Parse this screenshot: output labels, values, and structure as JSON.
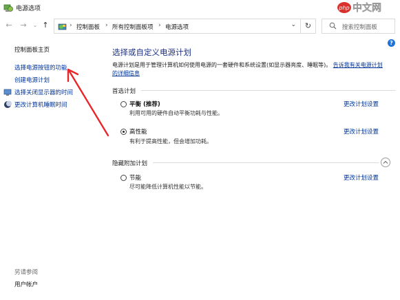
{
  "window": {
    "title": "电源选项",
    "watermark": "php中文网"
  },
  "address": {
    "crumbs": [
      "控制面板",
      "所有控制面板项",
      "电源选项"
    ]
  },
  "search": {
    "placeholder": "搜索控制面板"
  },
  "left_pane": {
    "home": "控制面板主页",
    "links": [
      "选择电源按钮的功能",
      "创建电源计划",
      "选择关闭显示器的时间",
      "更改计算机睡眠时间"
    ],
    "see_also_label": "另请参阅",
    "see_also_links": [
      "用户帐户"
    ]
  },
  "main": {
    "title": "选择或自定义电源计划",
    "description": "电源计划是用于管理计算机如何使用电源的一套硬件和系统设置(如显示器亮度、睡眠等)。",
    "description_link": "告诉我有关电源计划的详细信息",
    "preferred_group": "首选计划",
    "hidden_group": "隐藏附加计划",
    "plans": [
      {
        "name": "平衡 (推荐)",
        "desc": "利用可用的硬件自动平衡功耗与性能。",
        "link": "更改计划设置",
        "selected": false
      },
      {
        "name": "高性能",
        "desc": "有利于提高性能，但会增加功耗。",
        "link": "更改计划设置",
        "selected": true
      },
      {
        "name": "节能",
        "desc": "尽可能降低计算机性能以节能。",
        "link": "更改计划设置",
        "selected": false
      }
    ]
  },
  "colors": {
    "title_blue": "#1e3287",
    "link_blue": "#003399",
    "annotation_red": "#e8262a",
    "help_blue": "#1e73d8"
  }
}
